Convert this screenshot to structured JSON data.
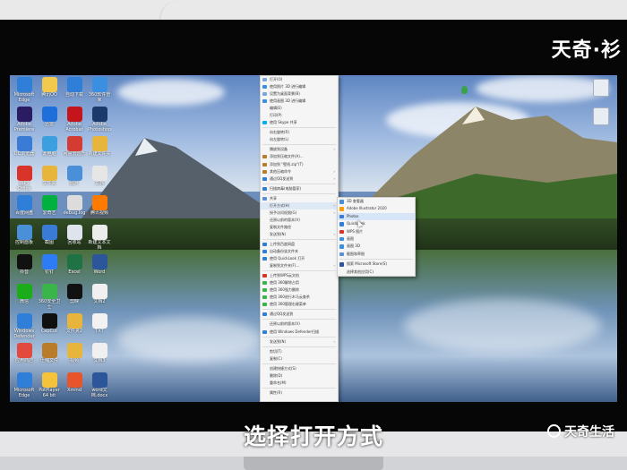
{
  "watermark": {
    "top": "天奇·衫",
    "bottom": "天奇生活"
  },
  "subtitle": "选择打开方式",
  "desktop_icons": [
    {
      "label": "Microsoft Edge",
      "color": "#2f7ed8"
    },
    {
      "label": "腾讯QQ",
      "color": "#f2c94c"
    },
    {
      "label": "自动下载",
      "color": "#2f7ed8"
    },
    {
      "label": "360软件管家",
      "color": "#3a8fe0"
    },
    {
      "label": "Adobe Premiere",
      "color": "#2a1c63"
    },
    {
      "label": "迅雷",
      "color": "#1e6fd9"
    },
    {
      "label": "Adobe Acrobat",
      "color": "#c4151c"
    },
    {
      "label": "Adobe Photoshop",
      "color": "#1b3a6b"
    },
    {
      "label": "UC浏览器",
      "color": "#3a7bd5"
    },
    {
      "label": "此电脑",
      "color": "#3ca0e0"
    },
    {
      "label": "网易云音乐",
      "color": "#d43c33"
    },
    {
      "label": "新建文件夹",
      "color": "#e7b53c"
    },
    {
      "label": "WPS Office",
      "color": "#d8342a"
    },
    {
      "label": "文件夹",
      "color": "#e7b53c"
    },
    {
      "label": "图片",
      "color": "#4a90d9"
    },
    {
      "label": "文档",
      "color": "#e6e6e6"
    },
    {
      "label": "百度网盘",
      "color": "#2f7ed8"
    },
    {
      "label": "爱奇艺",
      "color": "#00b140"
    },
    {
      "label": "debug.log",
      "color": "#dcdcdc"
    },
    {
      "label": "腾讯视频",
      "color": "#ff7a00"
    },
    {
      "label": "控制面板",
      "color": "#4a90d9"
    },
    {
      "label": "截图",
      "color": "#3a7bd5"
    },
    {
      "label": "回收站",
      "color": "#dde4ec"
    },
    {
      "label": "新建文本文档",
      "color": "#ececec"
    },
    {
      "label": "抖音",
      "color": "#111111"
    },
    {
      "label": "钉钉",
      "color": "#2e7bf6"
    },
    {
      "label": "Excel",
      "color": "#1f7244"
    },
    {
      "label": "Word",
      "color": "#2b579a"
    },
    {
      "label": "微信",
      "color": "#1aad19"
    },
    {
      "label": "360安全卫士",
      "color": "#3ab54a"
    },
    {
      "label": "剪映",
      "color": "#111111"
    },
    {
      "label": "文档2",
      "color": "#f0f0f0"
    },
    {
      "label": "Windows Defender",
      "color": "#2f7ed8"
    },
    {
      "label": "CapCut",
      "color": "#101010"
    },
    {
      "label": "文件夹2",
      "color": "#e7b53c"
    },
    {
      "label": "TXT",
      "color": "#f2f2f2"
    },
    {
      "label": "应用商店",
      "color": "#e14a3c"
    },
    {
      "label": "压缩文件",
      "color": "#b87c2a"
    },
    {
      "label": "视频",
      "color": "#e7b53c"
    },
    {
      "label": "文档3",
      "color": "#f0f0f0"
    },
    {
      "label": "Microsoft Edge",
      "color": "#2f7ed8"
    },
    {
      "label": "PotPlayer 64 bit",
      "color": "#f5c23c"
    },
    {
      "label": "Xmind",
      "color": "#e8552b"
    },
    {
      "label": "word文档.docx",
      "color": "#2b579a"
    }
  ],
  "context_menu": [
    {
      "label": "打开(O)",
      "color": "#7aa7e0"
    },
    {
      "label": "使用照片 3D 进行编辑",
      "color": "#3a8fe0"
    },
    {
      "label": "设置为桌面背景(B)",
      "color": "#7aa7e0"
    },
    {
      "label": "使用画图 3D 进行编辑",
      "color": "#3a8fe0"
    },
    {
      "label": "编辑(E)",
      "color": ""
    },
    {
      "label": "打印(P)",
      "color": ""
    },
    {
      "label": "使用 Skype 共享",
      "color": "#00aff0"
    },
    {
      "sep": true
    },
    {
      "label": "向右旋转(R)",
      "color": ""
    },
    {
      "label": "向左旋转(L)",
      "color": ""
    },
    {
      "sep": true
    },
    {
      "label": "播放到设备",
      "color": "",
      "arrow": true
    },
    {
      "label": "添加到压缩文件(A)...",
      "color": "#b87c2a"
    },
    {
      "label": "添加到 \"壁纸.zip\"(T)",
      "color": "#b87c2a"
    },
    {
      "label": "其他压缩命令",
      "color": "#b87c2a",
      "arrow": true
    },
    {
      "label": "通过QQ发送到",
      "color": "#2f7ed8",
      "arrow": true
    },
    {
      "sep": true
    },
    {
      "label": "扫描病毒(电脑管家)",
      "color": "#2f7ed8"
    },
    {
      "sep": true
    },
    {
      "label": "共享",
      "color": "#5b8fd6"
    },
    {
      "label": "打开方式(H)",
      "color": "",
      "arrow": true,
      "highlight": true
    },
    {
      "label": "授予访问权限(G)",
      "color": "",
      "arrow": true
    },
    {
      "label": "还原以前的版本(V)",
      "color": ""
    },
    {
      "label": "复制文件路径",
      "color": ""
    },
    {
      "label": "发送到(N)",
      "color": "",
      "arrow": true
    },
    {
      "sep": true
    },
    {
      "label": "上传到百度网盘",
      "color": "#2f7ed8"
    },
    {
      "label": "自动备份该文件夹",
      "color": "#2f7ed8"
    },
    {
      "label": "使用 QuickLook 打开",
      "color": "#2f7ed8"
    },
    {
      "label": "复制到文件夹(F)...",
      "color": "",
      "arrow": true
    },
    {
      "sep": true
    },
    {
      "label": "上传到WPS云文档",
      "color": "#d8342a"
    },
    {
      "label": "使用 360解除占用",
      "color": "#3ab54a"
    },
    {
      "label": "使用 360强力删除",
      "color": "#3ab54a"
    },
    {
      "label": "使用 360进行木马云查杀",
      "color": "#3ab54a"
    },
    {
      "label": "使用 360管理右键菜单",
      "color": "#3ab54a"
    },
    {
      "sep": true
    },
    {
      "label": "通过QQ发送到",
      "color": "#2f7ed8"
    },
    {
      "sep": true
    },
    {
      "label": "还原以前的版本(V)",
      "color": ""
    },
    {
      "label": "使用 Windows Defender扫描",
      "color": "#2f7ed8"
    },
    {
      "sep": true
    },
    {
      "label": "发送到(N)",
      "color": "",
      "arrow": true
    },
    {
      "sep": true
    },
    {
      "label": "剪切(T)",
      "color": ""
    },
    {
      "label": "复制(C)",
      "color": ""
    },
    {
      "sep": true
    },
    {
      "label": "创建快捷方式(S)",
      "color": ""
    },
    {
      "label": "删除(D)",
      "color": ""
    },
    {
      "label": "重命名(M)",
      "color": ""
    },
    {
      "sep": true
    },
    {
      "label": "属性(R)",
      "color": ""
    }
  ],
  "open_with_submenu": [
    {
      "label": "3D 查看器",
      "color": "#4a90d9"
    },
    {
      "label": "Adobe Illustrator 2020",
      "color": "#ff9a00"
    },
    {
      "label": "Photos",
      "color": "#3a7bd5",
      "highlight": true
    },
    {
      "label": "QuickLook",
      "color": "#2f7ed8"
    },
    {
      "label": "WPS 图片",
      "color": "#d8342a"
    },
    {
      "label": "画图",
      "color": "#3a8fe0"
    },
    {
      "label": "画图 3D",
      "color": "#3a8fe0"
    },
    {
      "label": "截图和草图",
      "color": "#5b8fd6"
    },
    {
      "sep": true
    },
    {
      "label": "搜索 Microsoft Store(S)",
      "color": "#2b579a"
    },
    {
      "label": "选择其他应用(C)",
      "color": ""
    }
  ]
}
